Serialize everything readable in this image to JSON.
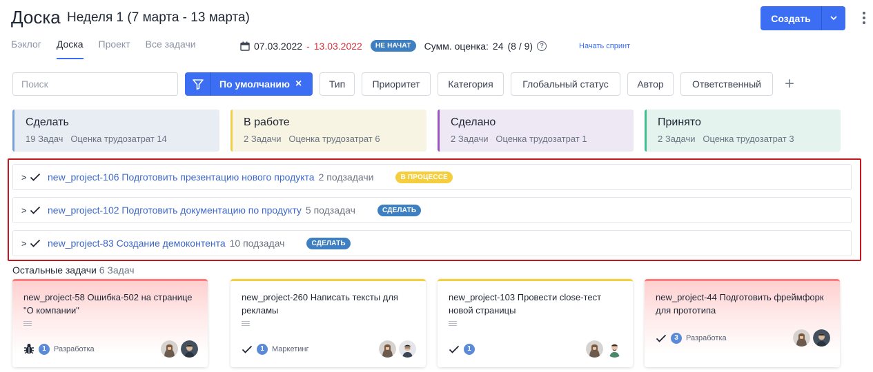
{
  "header": {
    "title": "Доска",
    "subtitle": "Неделя 1 (7 марта - 13 марта)",
    "create_label": "Создать"
  },
  "tabs": [
    {
      "label": "Бэклог",
      "active": false
    },
    {
      "label": "Доска",
      "active": true
    },
    {
      "label": "Проект",
      "active": false
    },
    {
      "label": "Все задачи",
      "active": false
    }
  ],
  "sprint": {
    "date_start": "07.03.2022",
    "separator": "-",
    "date_end": "13.03.2022",
    "status_badge": "НЕ НАЧАТ",
    "estimate_label": "Сумм. оценка:",
    "estimate_value": "24",
    "estimate_detail": "(8 / 9)",
    "help": "?",
    "start_link": "Начать спринт"
  },
  "filters": {
    "search_placeholder": "Поиск",
    "default_label": "По умолчанию",
    "clear": "×",
    "buttons": [
      "Тип",
      "Приоритет",
      "Категория",
      "Глобальный статус",
      "Автор",
      "Ответственный"
    ],
    "add": "+"
  },
  "columns": [
    {
      "title": "Сделать",
      "tasks": "19 Задач",
      "estimate": "Оценка трудозатрат 14",
      "color": "#e8edf4",
      "accent": "#7aa0d8"
    },
    {
      "title": "В работе",
      "tasks": "2 Задачи",
      "estimate": "Оценка трудозатрат 6",
      "color": "#f8f4e3",
      "accent": "#f2cf4a"
    },
    {
      "title": "Сделано",
      "tasks": "2 Задачи",
      "estimate": "Оценка трудозатрат 1",
      "color": "#ede8f3",
      "accent": "#9a55c0"
    },
    {
      "title": "Принято",
      "tasks": "2 Задачи",
      "estimate": "Оценка трудозатрат 3",
      "color": "#e4f3ee",
      "accent": "#3fbf8f"
    }
  ],
  "epics": [
    {
      "chevron": ">",
      "title": "new_project-106 Подготовить презентацию нового продукта",
      "subtasks": "2 подзадачи",
      "status": "В ПРОЦЕССЕ",
      "status_color": "#f4ce3e"
    },
    {
      "chevron": ">",
      "title": "new_project-102 Подготовить документацию по продукту",
      "subtasks": "5 подзадач",
      "status": "СДЕЛАТЬ",
      "status_color": "#3d7fc0"
    },
    {
      "chevron": ">",
      "title": "new_project-83 Создание демоконтента",
      "subtasks": "10 подзадач",
      "status": "СДЕЛАТЬ",
      "status_color": "#3d7fc0"
    }
  ],
  "others": {
    "label": "Остальные задачи",
    "count": "6 Задач"
  },
  "cards": [
    {
      "key": "new_project-58",
      "title": "Ошибка-502 на странице \"О компании\"",
      "type_icon": "bug-icon",
      "estimate": "1",
      "tag": "Разработка",
      "style": "red"
    },
    {
      "key": "new_project-260",
      "title": "Написать тексты для рекламы",
      "type_icon": "checkmark-icon",
      "estimate": "1",
      "tag": "Маркетинг",
      "style": "yellow"
    },
    {
      "key": "new_project-103",
      "title": "Провести close-тест новой страницы",
      "type_icon": "checkmark-icon",
      "estimate": "1",
      "tag": "",
      "style": "yellow"
    },
    {
      "key": "new_project-44",
      "title": "Подготовить фреймфорк для прототипа",
      "type_icon": "checkmark-icon",
      "estimate": "3",
      "tag": "Разработка",
      "style": "red"
    }
  ],
  "colors": {
    "primary": "#3b6ef2",
    "link": "#3d67c9",
    "danger": "#d6313a",
    "highlight_border": "#c4161c"
  }
}
